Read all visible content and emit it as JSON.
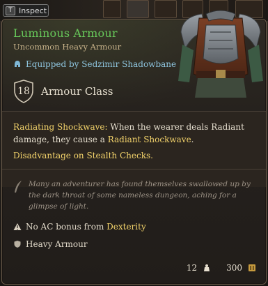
{
  "inspect": {
    "key": "T",
    "label": "Inspect"
  },
  "item": {
    "name": "Luminous Armour",
    "rarity_type": "Uncommon Heavy Armour",
    "equipped_by": "Equipped by Sedzimir Shadowbane",
    "armour_class_value": "18",
    "armour_class_label": "Armour Class"
  },
  "description": {
    "keyword": "Radiating Shockwave:",
    "text_1": " When the wearer deals Radiant damage, they cause a ",
    "highlight": "Radiant Shockwave",
    "text_2": ".",
    "disadvantage": "Disadvantage on Stealth Checks."
  },
  "flavor": "Many an adventurer has found themselves swallowed up by the dark throat of some nameless dungeon, aching for a glimpse of light.",
  "notes": {
    "no_ac_bonus_prefix": "No AC bonus from ",
    "no_ac_bonus_highlight": "Dexterity",
    "armour_type": "Heavy Armour"
  },
  "footer": {
    "weight": "12",
    "value": "300"
  },
  "colors": {
    "title": "#67c85a",
    "highlight": "#f3d36b",
    "equipped": "#8fc6e0"
  },
  "icons": {
    "equipped": "helmet-icon",
    "ac": "shield-icon",
    "flavor": "quill-icon",
    "warning": "warning-icon",
    "armour_type": "armour-shield-icon",
    "weight": "weight-icon",
    "value": "gold-coin-icon"
  }
}
